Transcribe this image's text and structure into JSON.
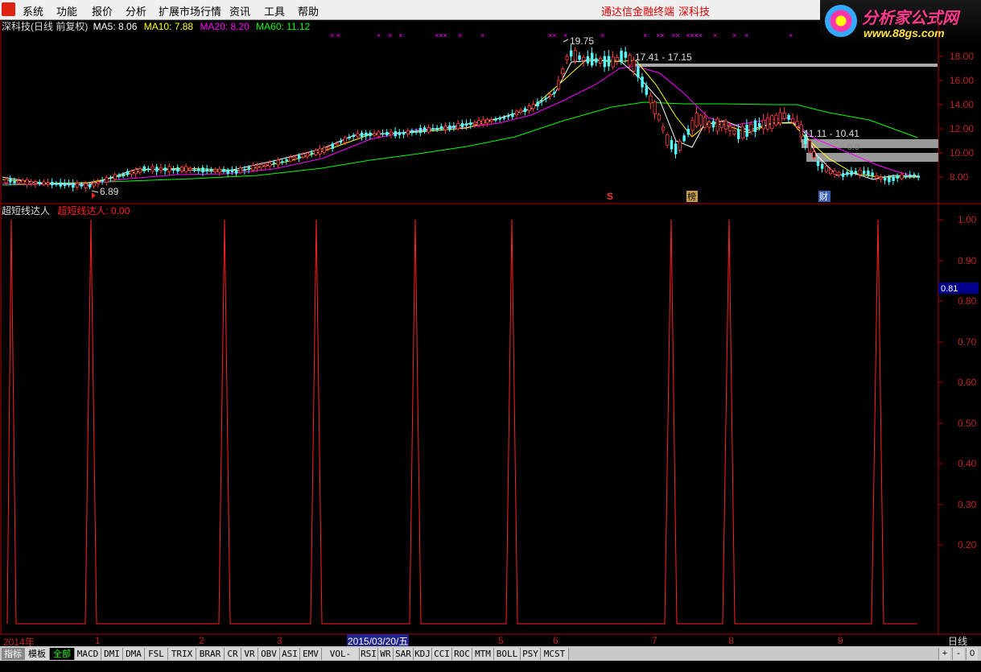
{
  "menu": {
    "items": [
      "系统",
      "功能",
      "报价",
      "分析",
      "扩展市场行情",
      "资讯",
      "工具",
      "帮助"
    ],
    "brand": "通达信金融终端",
    "stock": "深科技"
  },
  "watermark": {
    "name": "分析家公式网",
    "url": "www.88gs.com"
  },
  "colors": {
    "up": "#ff3c3c",
    "down": "#54ffff",
    "ma5": "#ffffff",
    "ma10": "#ffff00",
    "ma20": "#ff00ff",
    "ma60": "#00ff00",
    "axis": "#b00000",
    "indicator": "#ff2020"
  },
  "price_panel": {
    "legend": {
      "title": "深科技(日线 前复权)",
      "ma5": "MA5: 8.06",
      "ma10": "MA10: 7.88",
      "ma20": "MA20: 8.20",
      "ma60": "MA60: 11.12"
    },
    "annotations": {
      "high": "19.75",
      "low": "6.89",
      "range1": "17.41 - 17.15",
      "range2": "11.11 - 10.41",
      "range2_tail": "- 0.0"
    },
    "markers": [
      "S",
      "榜",
      "财"
    ],
    "axis_ticks": [
      "18.00",
      "16.00",
      "14.00",
      "12.00",
      "10.00",
      "8.00"
    ]
  },
  "indicator_panel": {
    "name": "超短线达人",
    "value_label": "超短线达人: 0.00",
    "current": "0.81",
    "axis_ticks": [
      "1.00",
      "0.90",
      "0.80",
      "0.70",
      "0.60",
      "0.50",
      "0.40",
      "0.30",
      "0.20"
    ]
  },
  "time_axis": {
    "labels": [
      "2014年",
      "1",
      "2",
      "3",
      "5",
      "6",
      "7",
      "8",
      "9"
    ],
    "cursor": "2015/03/20/五",
    "period": "日线"
  },
  "bottom_tabs": [
    "指标",
    "模板",
    "全部",
    "MACD",
    "DMI",
    "DMA",
    "FSL",
    "TRIX",
    "BRAR",
    "CR",
    "VR",
    "OBV",
    "ASI",
    "EMV",
    "VOL-TDX",
    "RSI",
    "WR",
    "SAR",
    "KDJ",
    "CCI",
    "ROC",
    "MTM",
    "BOLL",
    "PSY",
    "MCST"
  ],
  "right_buttons": [
    "+",
    "-",
    "0"
  ]
}
